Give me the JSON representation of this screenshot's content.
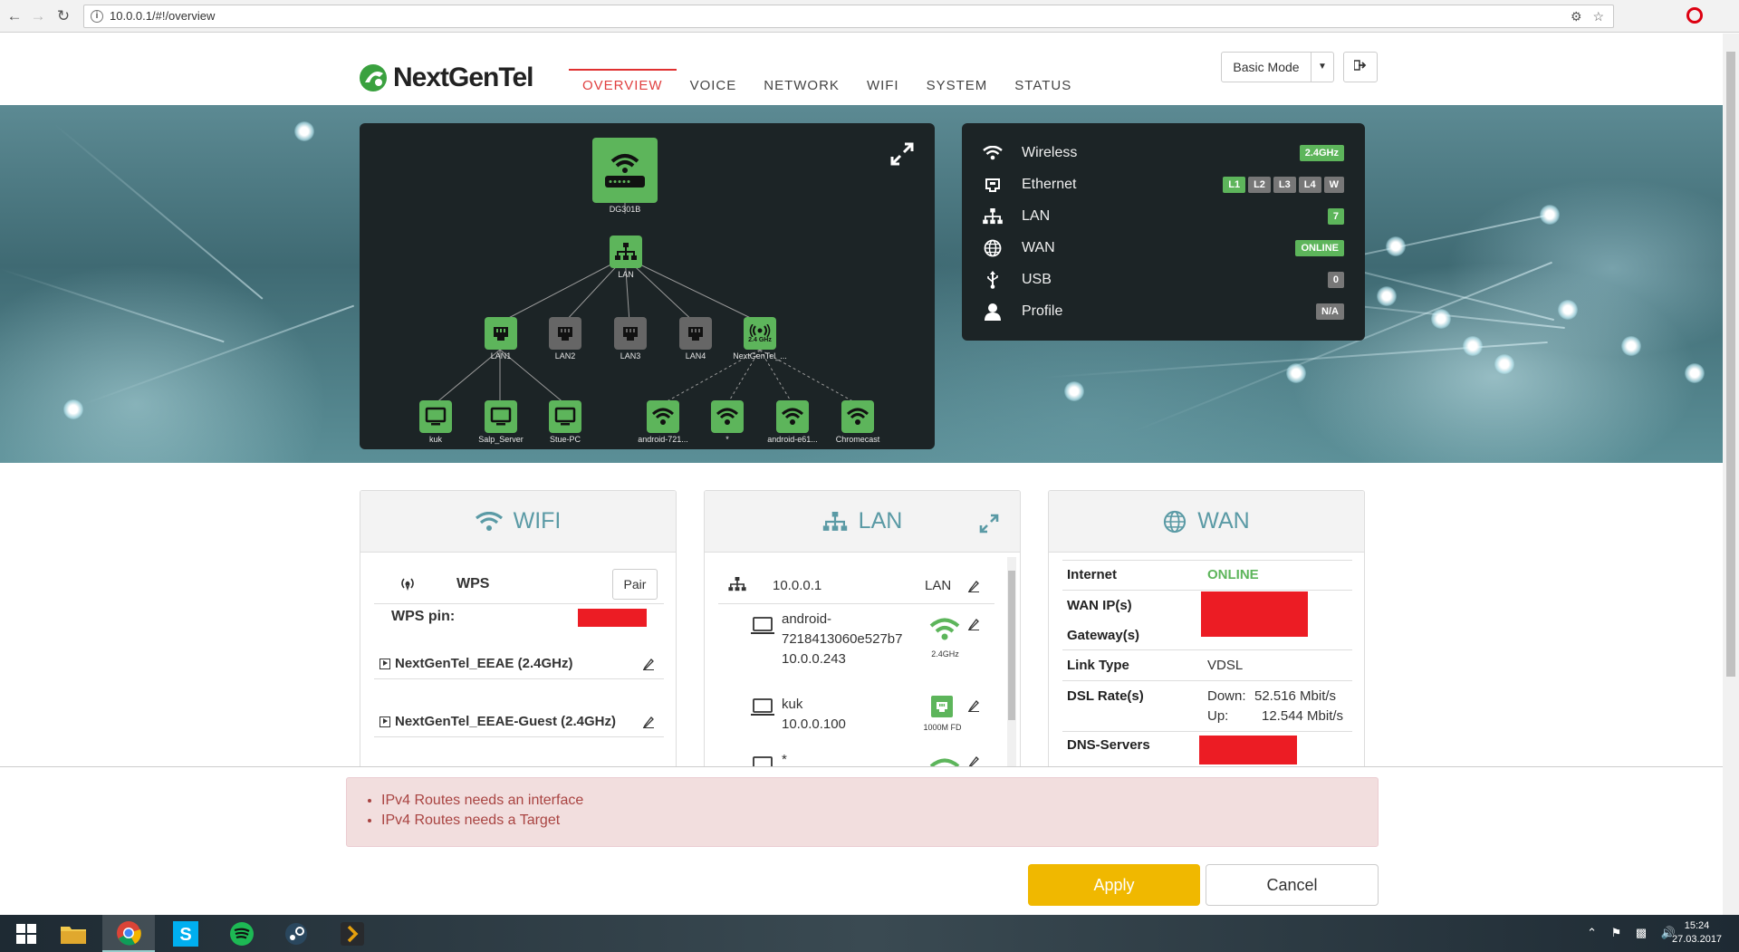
{
  "browser": {
    "url": "10.0.0.1/#!/overview"
  },
  "header": {
    "brand": "NextGenTel",
    "nav": [
      "OVERVIEW",
      "VOICE",
      "NETWORK",
      "WIFI",
      "SYSTEM",
      "STATUS"
    ],
    "active_nav": "OVERVIEW",
    "mode_label": "Basic Mode"
  },
  "topology": {
    "router_label": "DG301B",
    "lan_label": "LAN",
    "ports": [
      "LAN1",
      "LAN2",
      "LAN3",
      "LAN4",
      "NextGenTel_..."
    ],
    "ap_badge": "2.4 GHz",
    "clients": [
      "kuk",
      "Salp_Server",
      "Stue-PC",
      "android-721...",
      "*",
      "android-e61...",
      "Chromecast"
    ]
  },
  "status": {
    "rows": [
      {
        "label": "Wireless",
        "badges": [
          {
            "text": "2.4GHz",
            "color": "green"
          }
        ]
      },
      {
        "label": "Ethernet",
        "badges": [
          {
            "text": "L1",
            "color": "green"
          },
          {
            "text": "L2",
            "color": "grey"
          },
          {
            "text": "L3",
            "color": "grey"
          },
          {
            "text": "L4",
            "color": "grey"
          },
          {
            "text": "W",
            "color": "grey"
          }
        ]
      },
      {
        "label": "LAN",
        "badges": [
          {
            "text": "7",
            "color": "green"
          }
        ]
      },
      {
        "label": "WAN",
        "badges": [
          {
            "text": "ONLINE",
            "color": "green"
          }
        ]
      },
      {
        "label": "USB",
        "badges": [
          {
            "text": "0",
            "color": "grey"
          }
        ]
      },
      {
        "label": "Profile",
        "badges": [
          {
            "text": "N/A",
            "color": "grey"
          }
        ]
      }
    ]
  },
  "wifi_card": {
    "title": "WIFI",
    "wps_label": "WPS",
    "pair_label": "Pair",
    "wps_pin_label": "WPS pin:",
    "networks": [
      "NextGenTel_EEAE (2.4GHz)",
      "NextGenTel_EEAE-Guest (2.4GHz)"
    ]
  },
  "lan_card": {
    "title": "LAN",
    "host_ip": "10.0.0.1",
    "host_type": "LAN",
    "devices": [
      {
        "name_line1": "android-",
        "name_line2": "7218413060e527b7",
        "ip": "10.0.0.243",
        "link": "2.4GHz"
      },
      {
        "name_line1": "kuk",
        "name_line2": "",
        "ip": "10.0.0.100",
        "link": "1000M FD"
      },
      {
        "name_line1": "*",
        "name_line2": "",
        "ip": "",
        "link": ""
      }
    ]
  },
  "wan_card": {
    "title": "WAN",
    "internet_label": "Internet",
    "internet_value": "ONLINE",
    "wan_ip_label": "WAN IP(s)",
    "gateway_label": "Gateway(s)",
    "link_type_label": "Link Type",
    "link_type_value": "VDSL",
    "dsl_rate_label": "DSL Rate(s)",
    "down_label": "Down:",
    "down_value": "52.516 Mbit/s",
    "up_label": "Up:",
    "up_value": "12.544 Mbit/s",
    "dns_label": "DNS-Servers"
  },
  "alert": {
    "messages": [
      "IPv4 Routes needs an interface",
      "IPv4 Routes needs a Target"
    ]
  },
  "actions": {
    "apply": "Apply",
    "cancel": "Cancel"
  },
  "taskbar": {
    "time": "15:24",
    "date": "27.03.2017"
  },
  "colors": {
    "accent_green": "#5db55b",
    "apply_yellow": "#f0b800",
    "alert_bg": "#f2dede",
    "alert_text": "#a94442",
    "nav_active": "#e04040"
  }
}
